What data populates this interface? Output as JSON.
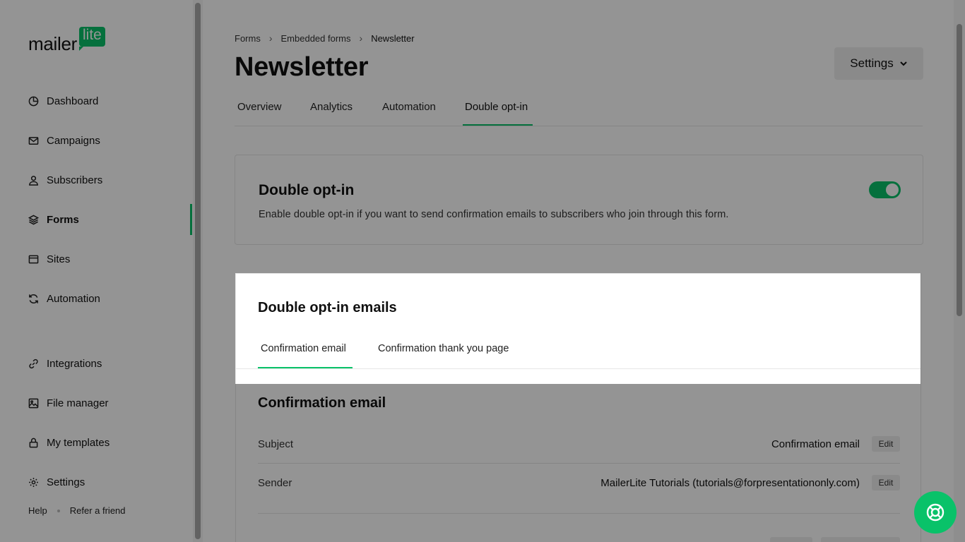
{
  "brand": {
    "word": "mailer",
    "badge": "lite",
    "accent_color": "#09c269"
  },
  "sidebar": {
    "items": [
      {
        "label": "Dashboard",
        "icon": "dashboard-icon"
      },
      {
        "label": "Campaigns",
        "icon": "mail-icon"
      },
      {
        "label": "Subscribers",
        "icon": "user-icon"
      },
      {
        "label": "Forms",
        "icon": "layers-icon",
        "active": true
      },
      {
        "label": "Sites",
        "icon": "browser-icon"
      },
      {
        "label": "Automation",
        "icon": "refresh-icon"
      },
      {
        "label": "Integrations",
        "icon": "link-icon"
      },
      {
        "label": "File manager",
        "icon": "image-icon"
      },
      {
        "label": "My templates",
        "icon": "lock-icon"
      },
      {
        "label": "Settings",
        "icon": "gear-icon"
      }
    ],
    "footer": {
      "help": "Help",
      "refer": "Refer a friend"
    }
  },
  "breadcrumb": [
    "Forms",
    "Embedded forms",
    "Newsletter"
  ],
  "page": {
    "title": "Newsletter",
    "settings_label": "Settings"
  },
  "tabs": [
    "Overview",
    "Analytics",
    "Automation",
    "Double opt-in"
  ],
  "active_tab": "Double opt-in",
  "double_opt_in": {
    "title": "Double opt-in",
    "description": "Enable double opt-in if you want to send confirmation emails to subscribers who join through this form.",
    "enabled": true
  },
  "emails_card": {
    "title": "Double opt-in emails",
    "subtabs": [
      "Confirmation email",
      "Confirmation thank you page"
    ],
    "active_subtab": "Confirmation email",
    "section_title": "Confirmation email",
    "rows": [
      {
        "label": "Subject",
        "value": "Confirmation email",
        "action": "Edit"
      },
      {
        "label": "Sender",
        "value": "MailerLite Tutorials (tutorials@forpresentationonly.com)",
        "action": "Edit"
      }
    ]
  }
}
